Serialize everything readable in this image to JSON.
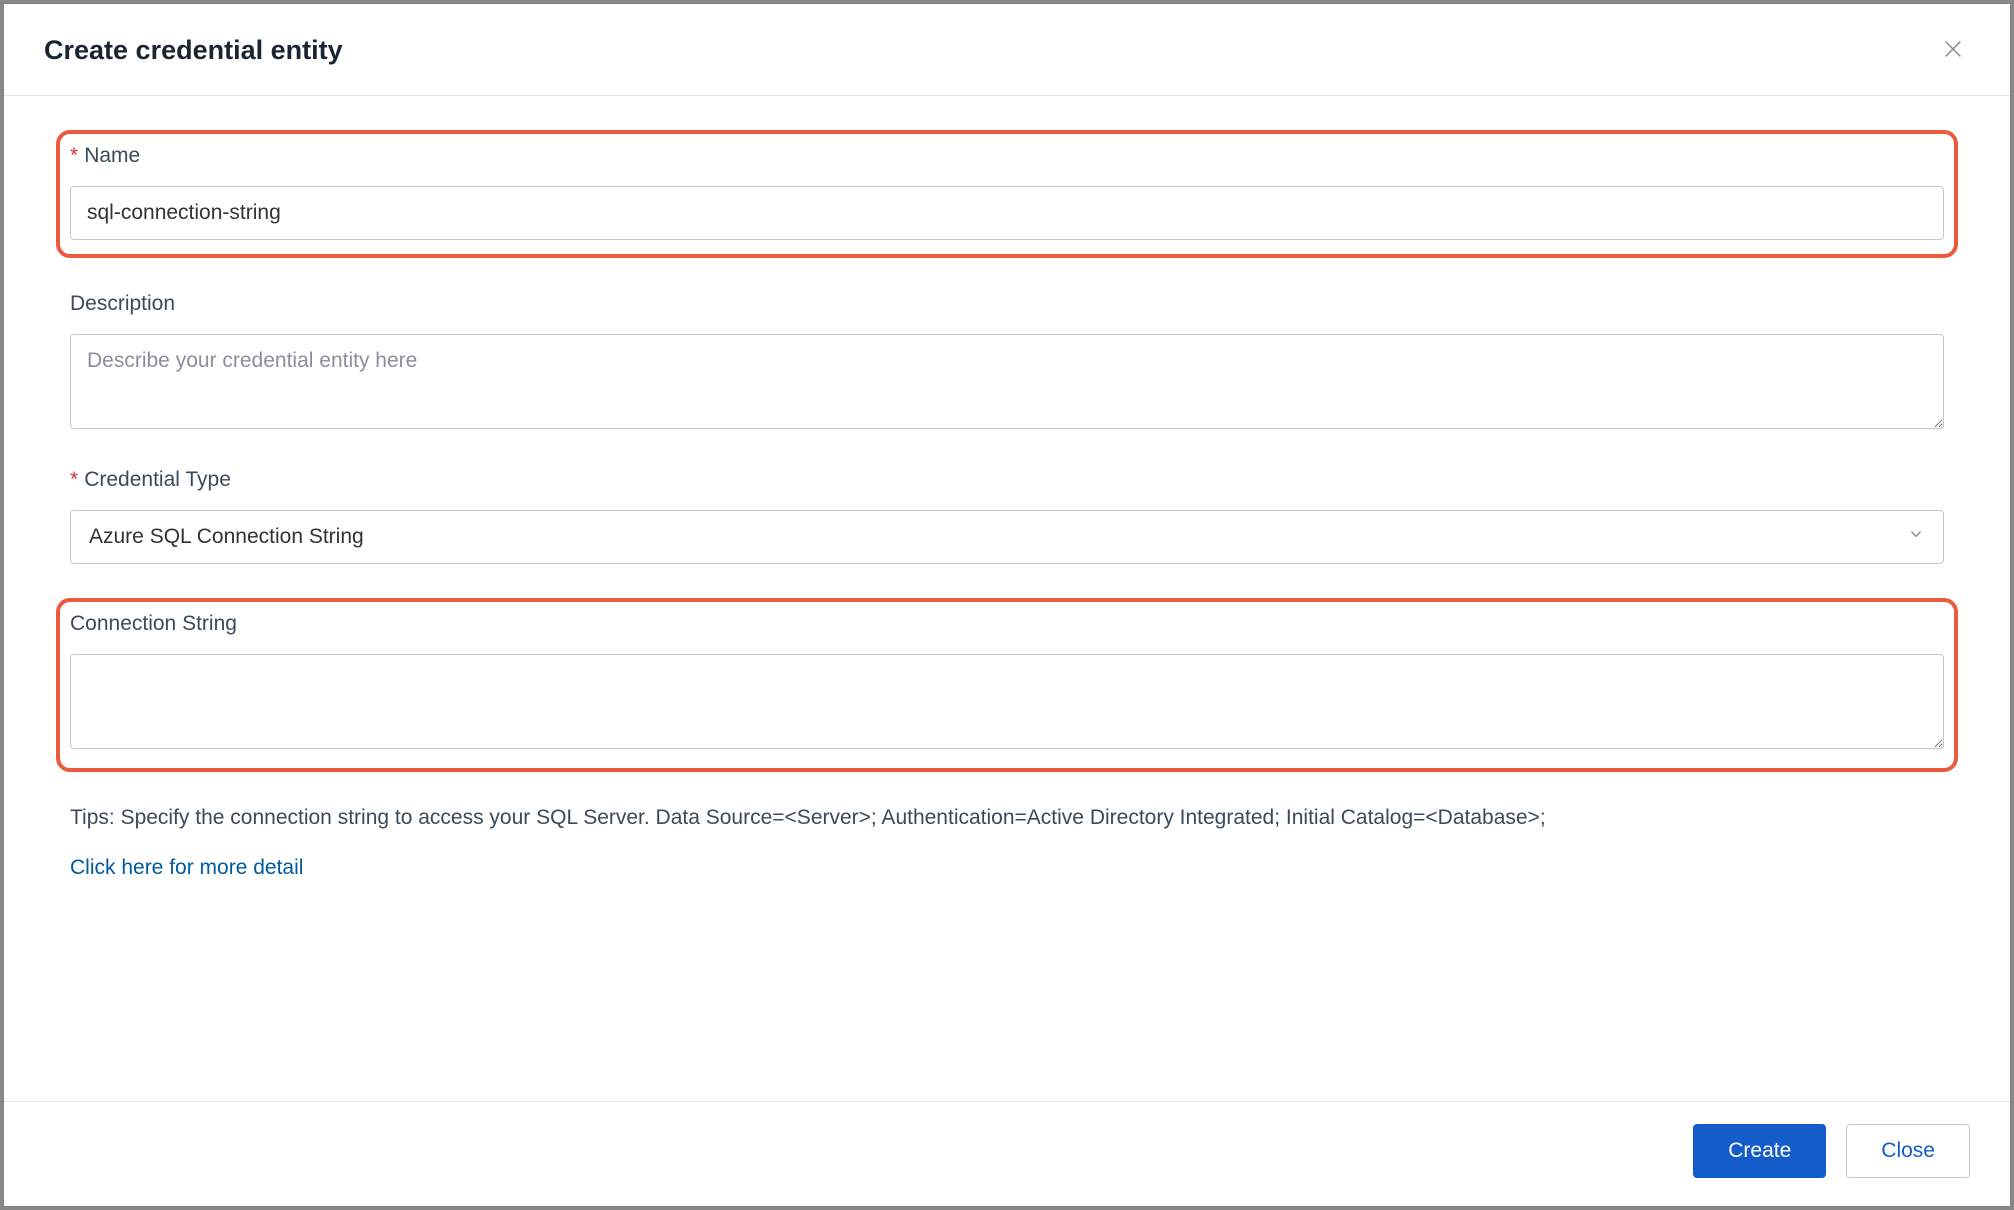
{
  "modal": {
    "title": "Create credential entity"
  },
  "form": {
    "name": {
      "label": "Name",
      "value": "sql-connection-string"
    },
    "description": {
      "label": "Description",
      "placeholder": "Describe your credential entity here",
      "value": ""
    },
    "credentialType": {
      "label": "Credential Type",
      "selected": "Azure SQL Connection String"
    },
    "connectionString": {
      "label": "Connection String",
      "value": ""
    },
    "tips": "Tips: Specify the connection string to access your SQL Server. Data Source=<Server>; Authentication=Active Directory Integrated; Initial Catalog=<Database>;",
    "moreDetailLink": "Click here for more detail"
  },
  "footer": {
    "create": "Create",
    "close": "Close"
  }
}
